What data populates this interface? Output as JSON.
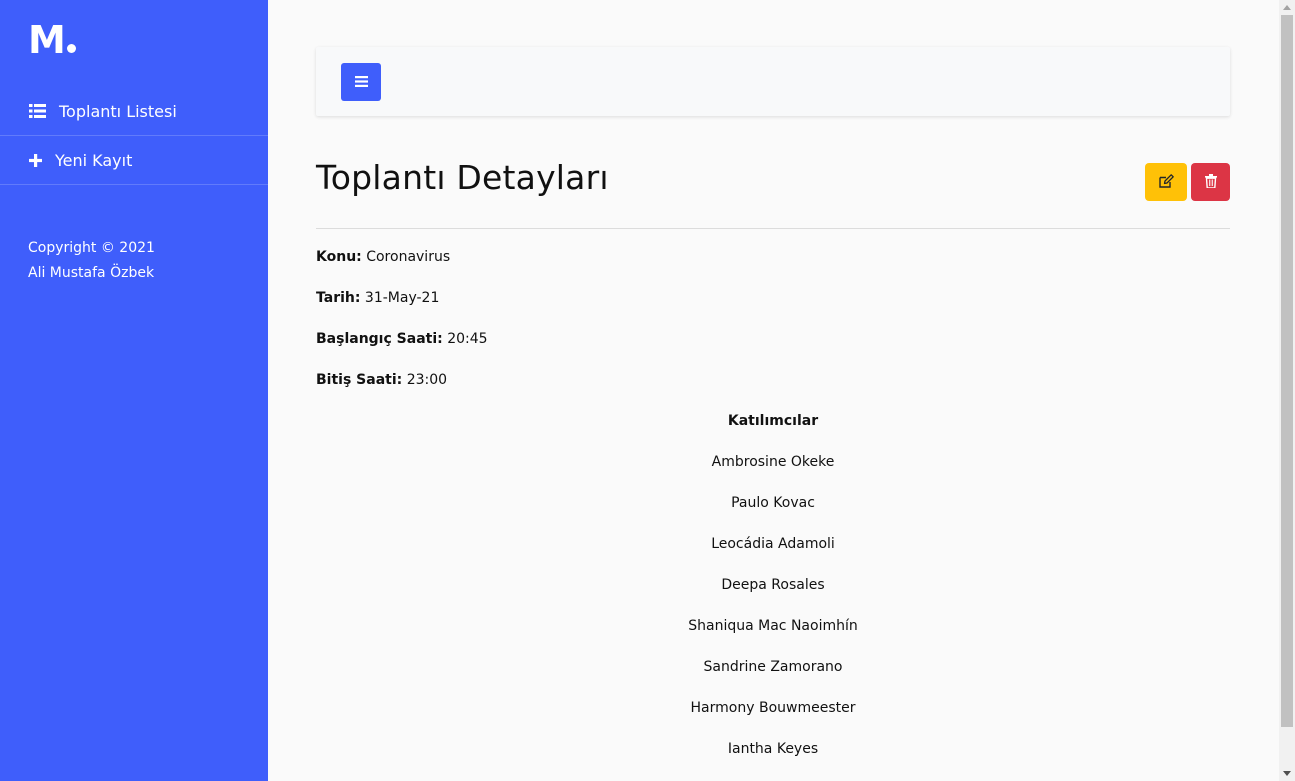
{
  "sidebar": {
    "logo": "M",
    "items": [
      {
        "label": "Toplantı Listesi",
        "icon": "list-icon"
      },
      {
        "label": "Yeni Kayıt",
        "icon": "plus-icon"
      }
    ],
    "copyright_line1": "Copyright © 2021",
    "copyright_line2": "Ali Mustafa Özbek"
  },
  "main": {
    "title": "Toplantı Detayları",
    "details": [
      {
        "label": "Konu:",
        "value": "Coronavirus"
      },
      {
        "label": "Tarih:",
        "value": "31-May-21"
      },
      {
        "label": "Başlangıç Saati:",
        "value": "20:45"
      },
      {
        "label": "Bitiş Saati:",
        "value": "23:00"
      }
    ],
    "participants_heading": "Katılımcılar",
    "participants": [
      "Ambrosine Okeke",
      "Paulo Kovac",
      "Leocádia Adamoli",
      "Deepa Rosales",
      "Shaniqua Mac Naoimhín",
      "Sandrine Zamorano",
      "Harmony Bouwmeester",
      "Iantha Keyes"
    ]
  },
  "colors": {
    "sidebar": "#3f5efb",
    "primary": "#3f5efb",
    "warning": "#ffc107",
    "danger": "#dc3545"
  }
}
